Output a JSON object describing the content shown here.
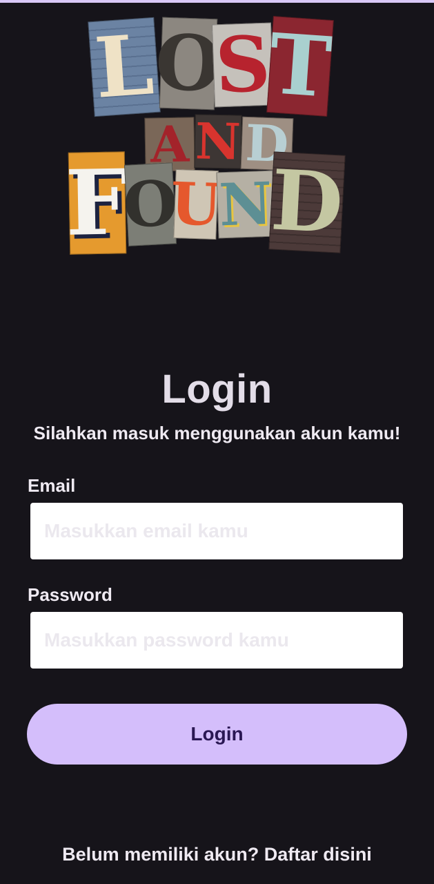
{
  "logo": {
    "letters": {
      "l": "L",
      "o": "O",
      "s": "S",
      "t": "T",
      "a": "A",
      "n1": "N",
      "d1": "D",
      "f": "F",
      "o2": "O",
      "u": "U",
      "n2": "N",
      "d2": "D"
    }
  },
  "login": {
    "title": "Login",
    "subtitle": "Silahkan masuk menggunakan akun kamu!",
    "email_label": "Email",
    "email_placeholder": "Masukkan email kamu",
    "email_value": "",
    "password_label": "Password",
    "password_placeholder": "Masukkan password kamu",
    "password_value": "",
    "button_label": "Login"
  },
  "footer": {
    "prompt": "Belum memiliki akun?",
    "register_link": "Daftar disini"
  },
  "colors": {
    "background": "#16141a",
    "accent": "#d4befb",
    "button_text": "#2a1753"
  }
}
